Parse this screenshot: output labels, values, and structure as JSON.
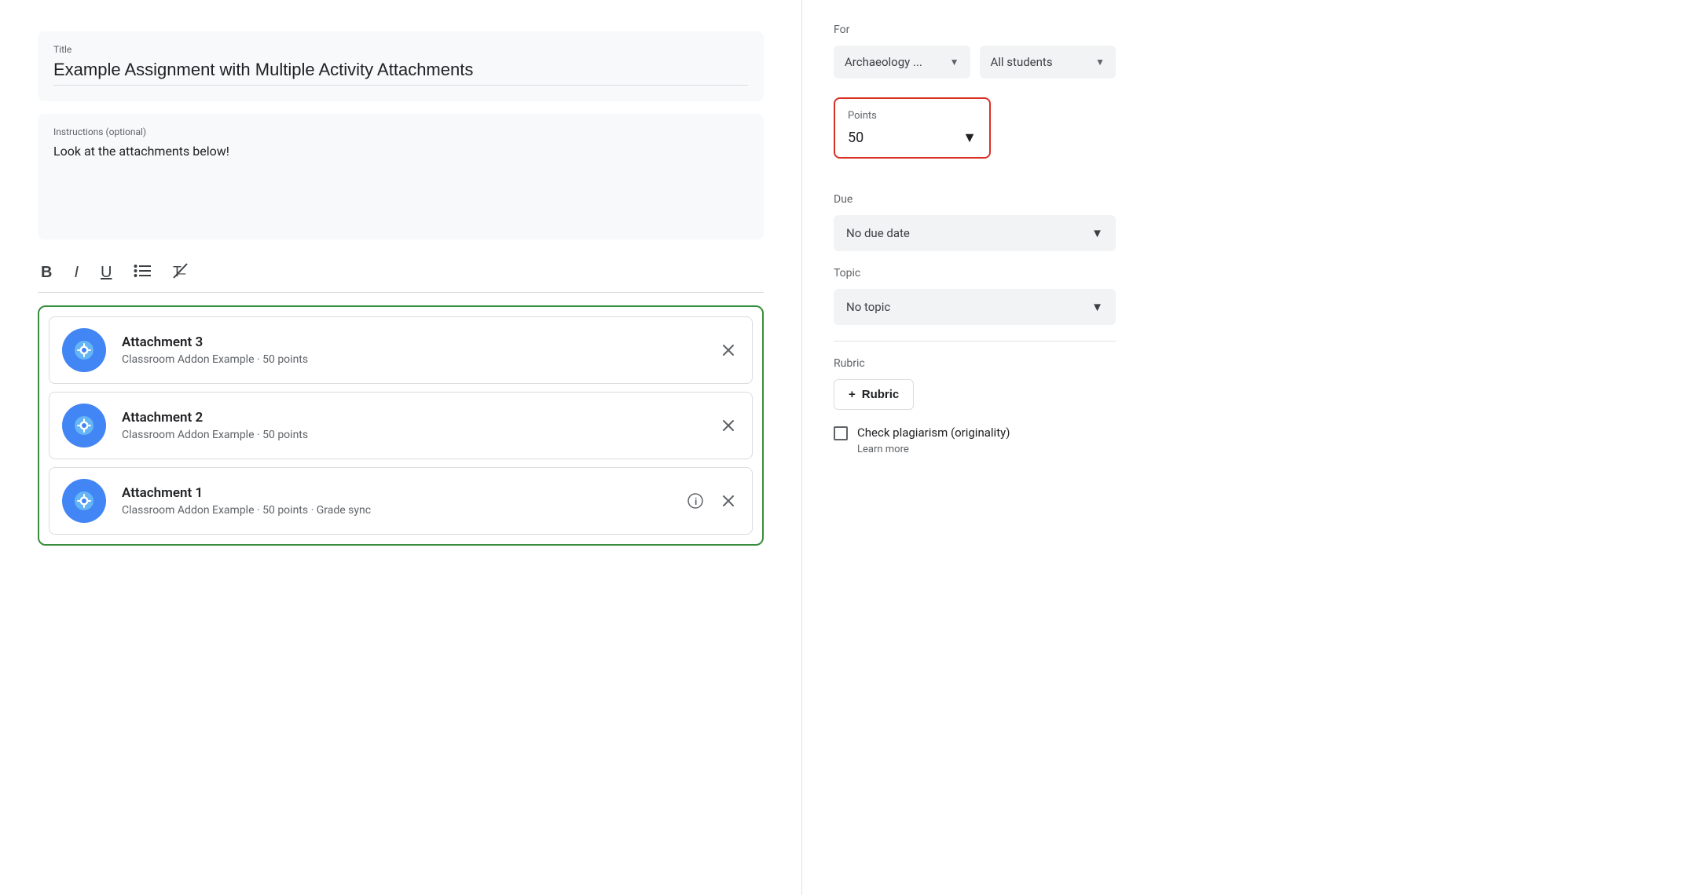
{
  "left": {
    "title_label": "Title",
    "title_value": "Example Assignment with Multiple Activity Attachments",
    "instructions_label": "Instructions (optional)",
    "instructions_value": "Look at the attachments below!",
    "toolbar": {
      "bold": "B",
      "italic": "I",
      "underline": "U",
      "list": "≡",
      "clear": "✕"
    },
    "attachments": [
      {
        "name": "Attachment 3",
        "meta": "Classroom Addon Example · 50 points",
        "has_info": false
      },
      {
        "name": "Attachment 2",
        "meta": "Classroom Addon Example · 50 points",
        "has_info": false
      },
      {
        "name": "Attachment 1",
        "meta": "Classroom Addon Example · 50 points · Grade sync",
        "has_info": true
      }
    ]
  },
  "right": {
    "for_label": "For",
    "class_value": "Archaeology ...",
    "students_value": "All students",
    "points_label": "Points",
    "points_value": "50",
    "due_label": "Due",
    "due_value": "No due date",
    "topic_label": "Topic",
    "topic_value": "No topic",
    "rubric_label": "Rubric",
    "rubric_btn": "Rubric",
    "plus_icon": "+",
    "plagiarism_label": "Check plagiarism (originality)",
    "learn_more": "Learn more"
  }
}
